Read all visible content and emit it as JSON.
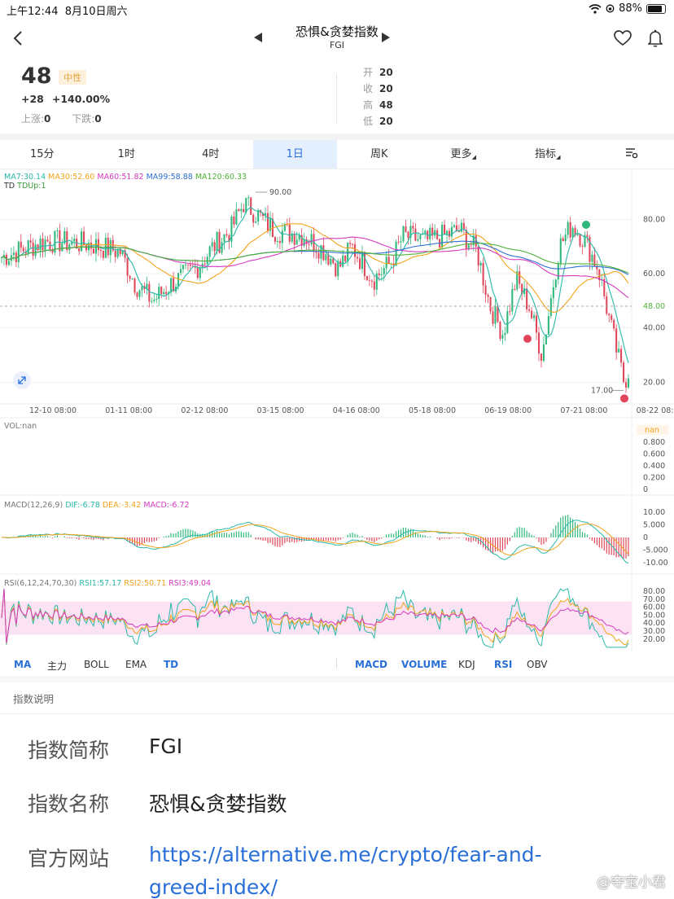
{
  "status": {
    "time": "上午12:44",
    "date": "8月10日周六",
    "battery": "88%"
  },
  "nav": {
    "title": "恐惧&贪婪指数",
    "subtitle": "FGI"
  },
  "quote": {
    "value": "48",
    "badge": "中性",
    "change": "+28",
    "change_pct": "+140.00%",
    "up_label": "上涨:",
    "up_value": "0",
    "down_label": "下跌:",
    "down_value": "0",
    "ohlc": [
      {
        "k": "开",
        "v": "20"
      },
      {
        "k": "收",
        "v": "20"
      },
      {
        "k": "高",
        "v": "48"
      },
      {
        "k": "低",
        "v": "20"
      }
    ]
  },
  "tabs": [
    "15分",
    "1时",
    "4时",
    "1日",
    "周K",
    "更多",
    "指标"
  ],
  "active_tab": "1日",
  "main_chart": {
    "ma_legend": [
      "MA7:30.14",
      "MA30:52.60",
      "MA60:51.82",
      "MA99:58.88",
      "MA120:60.33"
    ],
    "ma_colors": [
      "#29b9a8",
      "#f2a31b",
      "#d63bc0",
      "#2d6fd1",
      "#4fb238"
    ],
    "td_legend": "TD",
    "td_value": "TDUp:1",
    "y_ticks": [
      "80.00",
      "60.00",
      "40.00",
      "20.00"
    ],
    "y_values": [
      80,
      60,
      40,
      20
    ],
    "ylim": [
      12,
      96
    ],
    "current": "48.00",
    "current_value": 48,
    "high_label": "90.00",
    "high_value": 90,
    "low_label": "17.00",
    "low_value": 17,
    "x_ticks": [
      "12-10 08:00",
      "01-11 08:00",
      "02-12 08:00",
      "03-15 08:00",
      "04-16 08:00",
      "05-18 08:00",
      "06-19 08:00",
      "07-21 08:00",
      "08-22 08:"
    ]
  },
  "vol_panel": {
    "label": "VOL:nan",
    "badge": "nan",
    "ticks": [
      "0.800",
      "0.600",
      "0.400",
      "0.200",
      "0"
    ]
  },
  "macd_panel": {
    "label": "MACD(12,26,9)",
    "dif": "DIF:-6.78",
    "dea": "DEA:-3.42",
    "macd": "MACD:-6.72",
    "ticks": [
      "10.00",
      "5.000",
      "0",
      "-5.000",
      "-10.00"
    ]
  },
  "rsi_panel": {
    "label": "RSI(6,12,24,70,30)",
    "rsi1": "RSI1:57.17",
    "rsi2": "RSI2:50.71",
    "rsi3": "RSI3:49.04",
    "ticks": [
      "80.00",
      "70.00",
      "60.00",
      "50.00",
      "40.00",
      "30.00",
      "20.00"
    ]
  },
  "indicators_left": [
    "MA",
    "主力",
    "BOLL",
    "EMA",
    "TD"
  ],
  "indicators_right": [
    "MACD",
    "VOLUME",
    "KDJ",
    "RSI",
    "OBV"
  ],
  "section_title": "指数说明",
  "info": {
    "short_label": "指数简称",
    "short_value": "FGI",
    "name_label": "指数名称",
    "name_value": "恐惧&贪婪指数",
    "site_label": "官方网站",
    "site_line1": "https://alternative.me/crypto/fear-and-",
    "site_line2": "greed-index/"
  },
  "watermark": "@夺宝小君",
  "colors": {
    "up": "#2fb87b",
    "down": "#e0475a",
    "accent": "#2a6fd8"
  }
}
